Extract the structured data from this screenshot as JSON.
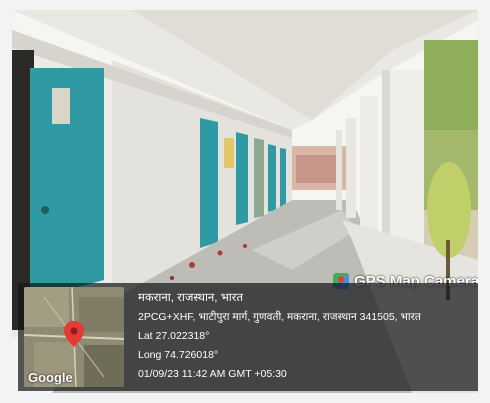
{
  "overlay": {
    "app_name": "GPS Map Camera",
    "app_icon": "gps-map-camera-icon",
    "place": "मकराना, राजस्थान, भारत",
    "address": "2PCG+XHF, भाटीपुरा मार्ग, गुणवती, मकराना, राजस्थान 341505, भारत",
    "lat": "Lat 27.022318°",
    "long": "Long 74.726018°",
    "datetime": "01/09/23 11:42 AM GMT +05:30",
    "map_brand": "Google"
  },
  "colors": {
    "door": "#2f9aa3",
    "wall": "#eceae4",
    "floor": "#bdbcb6",
    "sky": "#f4f6f7",
    "overlay_bg": "#141618",
    "map_pin": "#e53935"
  }
}
